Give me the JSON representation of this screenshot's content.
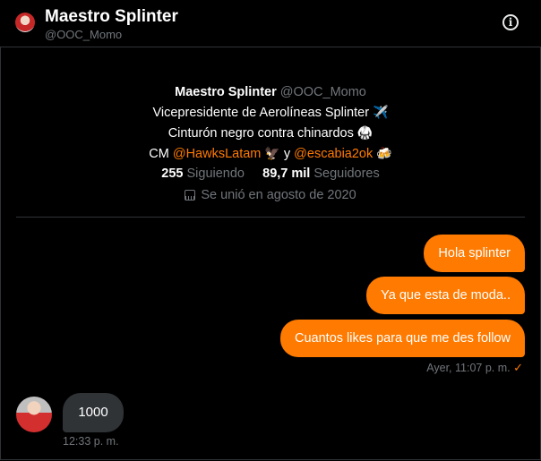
{
  "header": {
    "name": "Maestro Splinter",
    "handle": "@OOC_Momo",
    "info_label": "i"
  },
  "profile": {
    "name": "Maestro Splinter",
    "handle": "@OOC_Momo",
    "bio_line1": "Vicepresidente de Aerolíneas Splinter",
    "bio_line1_emoji": "✈️",
    "bio_line2": "Cinturón negro contra chinardos",
    "bio_line2_emoji": "🥋",
    "bio_line3_prefix": "CM",
    "mention1": "@HawksLatam",
    "mention1_emoji": "🦅",
    "joiner": "y",
    "mention2": "@escabia2ok",
    "mention2_emoji": "🍻",
    "following_count": "255",
    "following_label": "Siguiendo",
    "followers_count": "89,7 mil",
    "followers_label": "Seguidores",
    "joined": "Se unió en agosto de 2020"
  },
  "messages": {
    "outgoing": [
      {
        "text": "Hola splinter"
      },
      {
        "text": "Ya que esta de moda.."
      },
      {
        "text": "Cuantos likes para que me des follow"
      }
    ],
    "outgoing_time": "Ayer, 11:07 p. m.",
    "incoming": {
      "text": "1000",
      "time": "12:33 p. m."
    }
  },
  "colors": {
    "accent": "#ff7a00",
    "background": "#000000",
    "incoming_bubble": "#2f3336",
    "muted": "#71767b"
  }
}
